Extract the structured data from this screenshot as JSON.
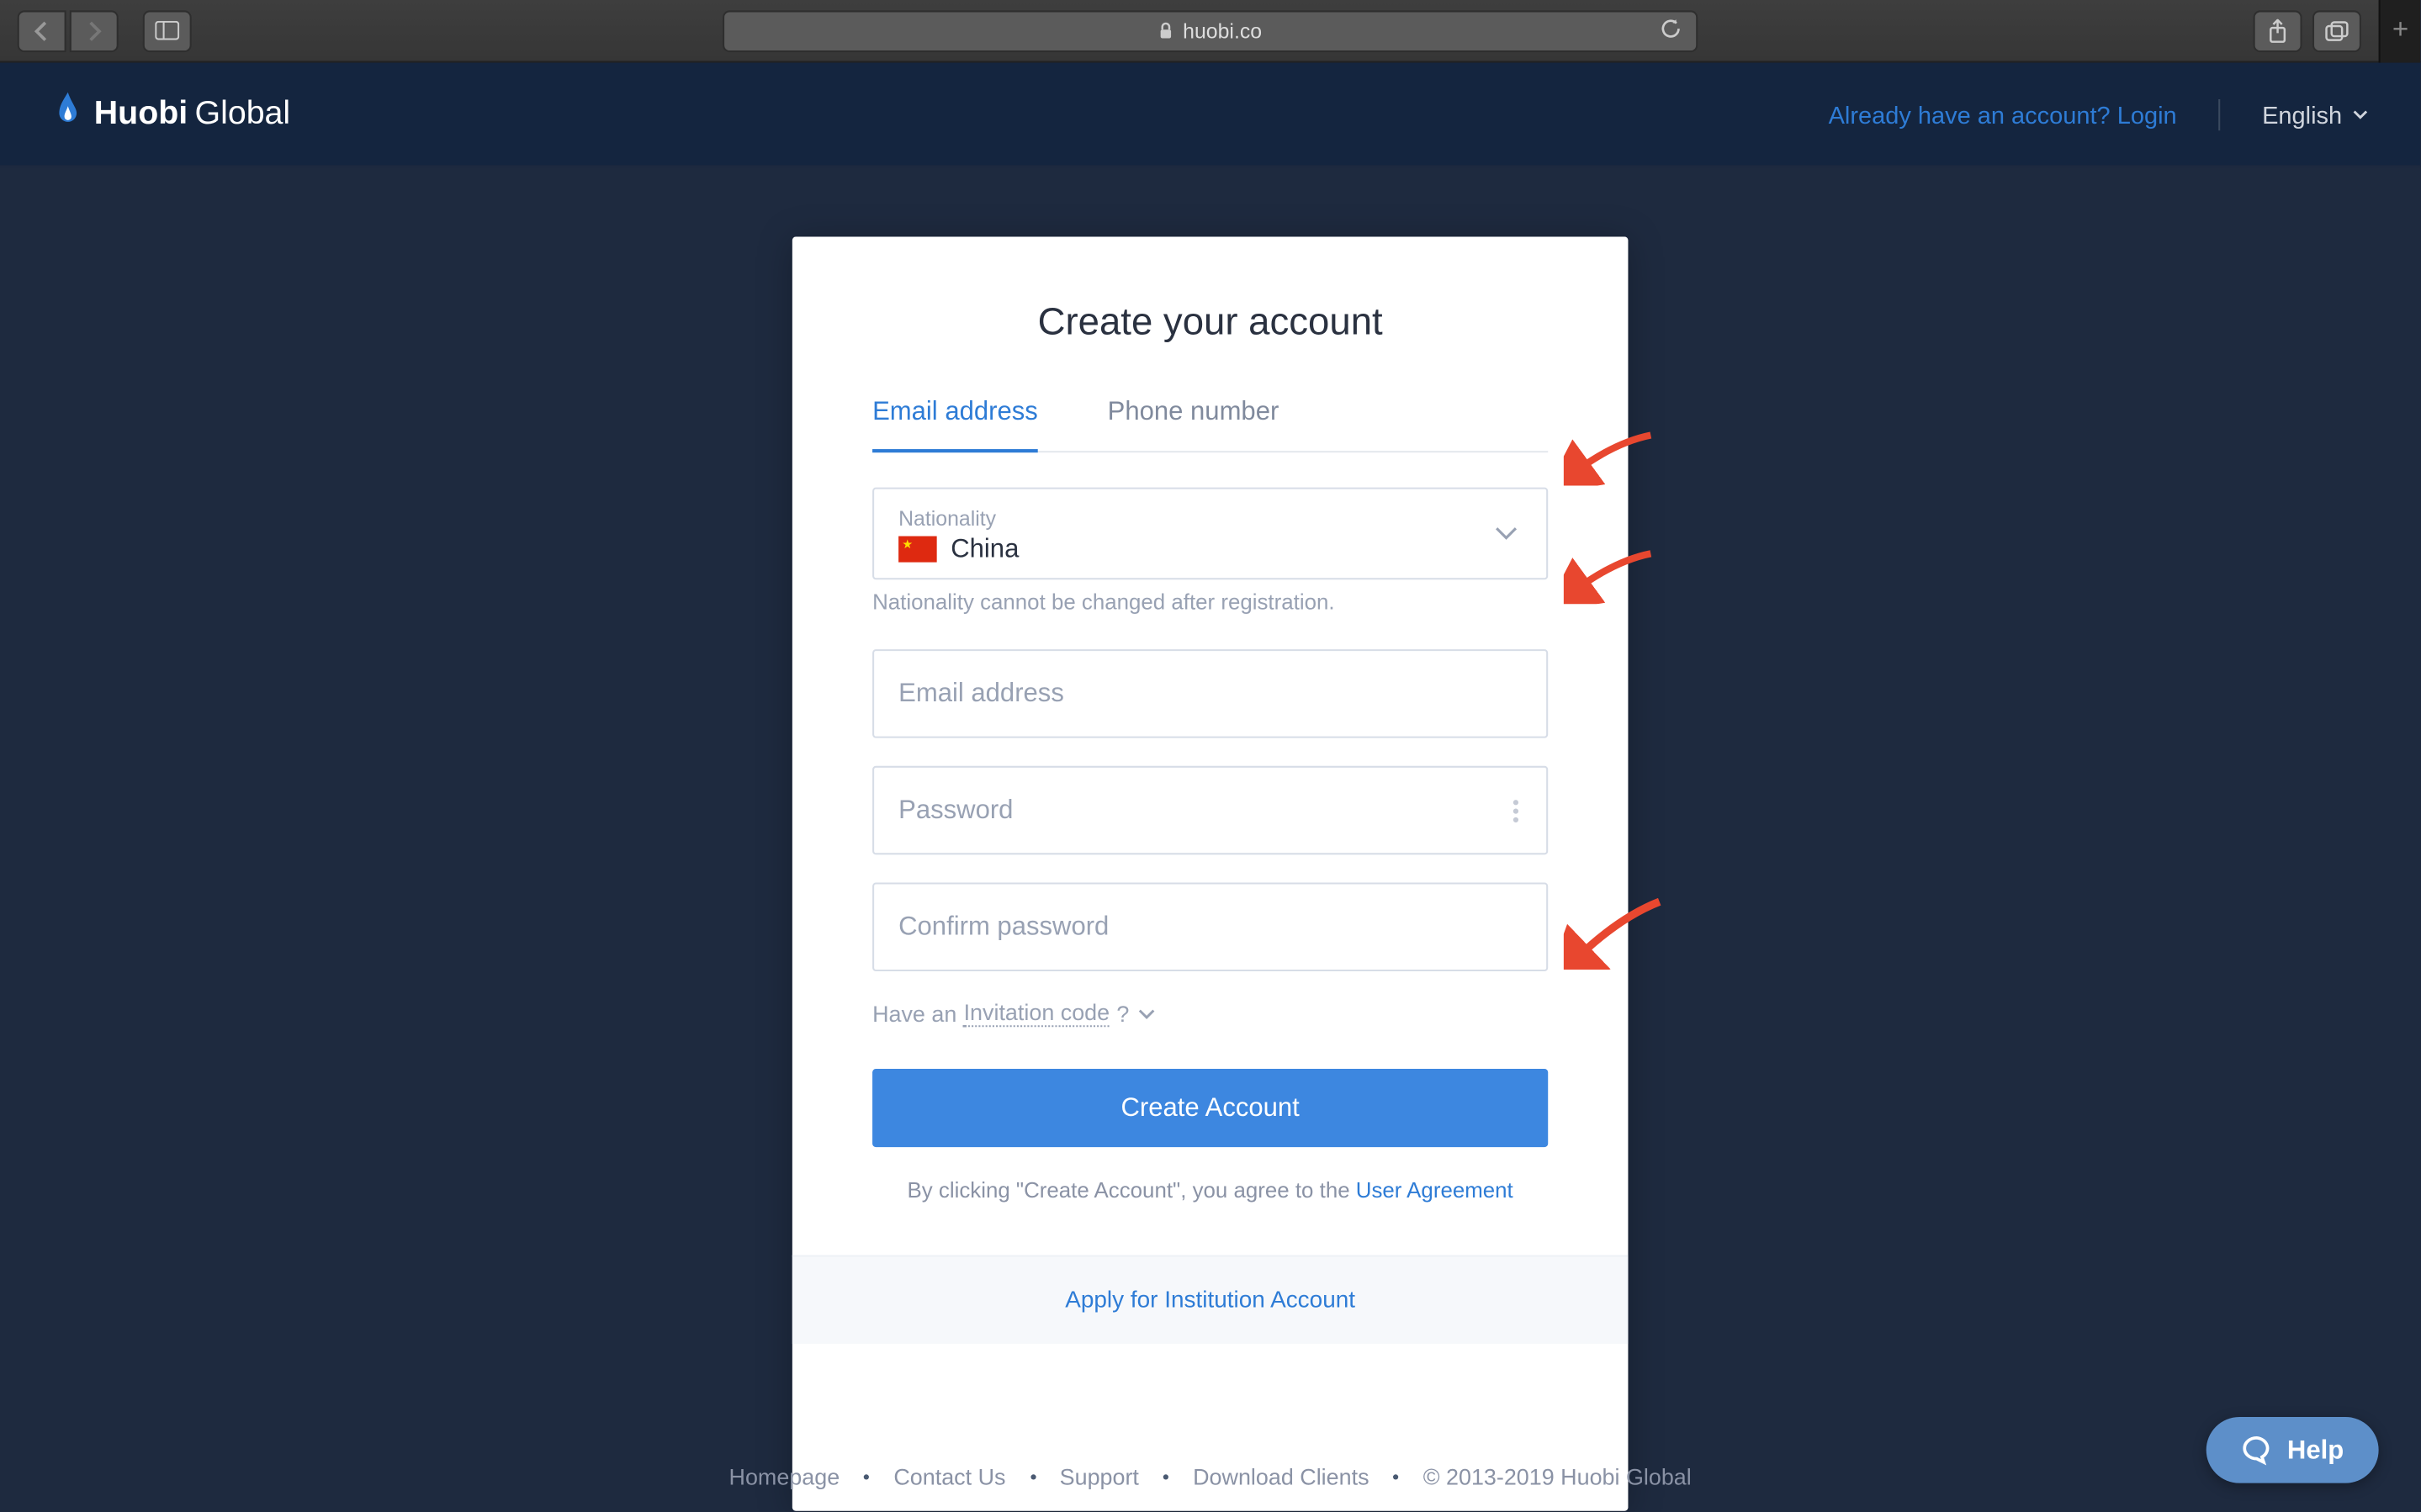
{
  "browser": {
    "url": "huobi.co"
  },
  "header": {
    "logo_brand": "Huobi",
    "logo_suffix": "Global",
    "login_prompt": "Already have an account? Login",
    "language": "English"
  },
  "card": {
    "title": "Create your account",
    "tabs": {
      "email": "Email address",
      "phone": "Phone number"
    },
    "nationality_label": "Nationality",
    "nationality_value": "China",
    "nationality_helper": "Nationality cannot be changed after registration.",
    "email_placeholder": "Email address",
    "password_placeholder": "Password",
    "confirm_placeholder": "Confirm password",
    "invitation_prefix": "Have an ",
    "invitation_code": "Invitation code",
    "invitation_suffix": "?",
    "submit_label": "Create Account",
    "agreement_prefix": "By clicking \"Create Account\",  you agree to the ",
    "agreement_link": "User Agreement",
    "institution_link": "Apply for Institution Account"
  },
  "footer": {
    "links": {
      "homepage": "Homepage",
      "contact": "Contact Us",
      "support": "Support",
      "download": "Download Clients"
    },
    "copyright": "© 2013-2019 Huobi Global"
  },
  "help_widget": "Help"
}
